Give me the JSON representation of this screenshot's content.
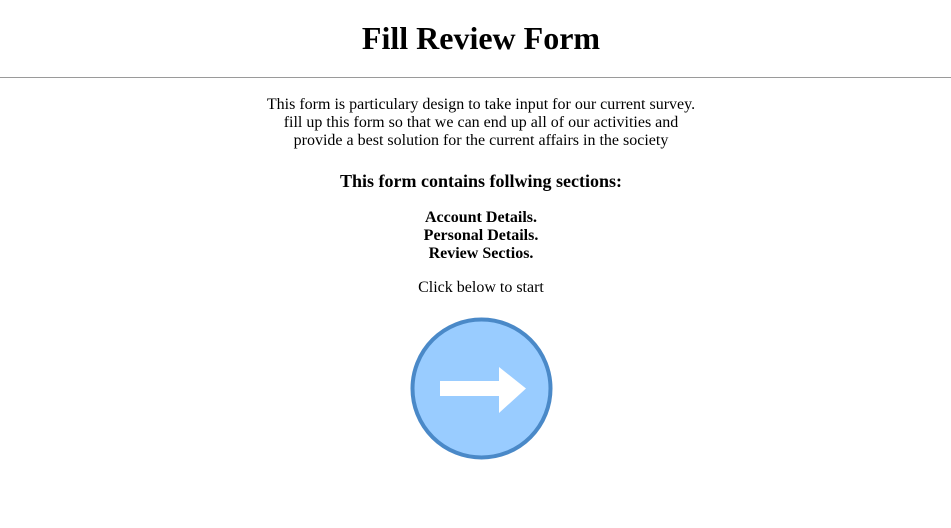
{
  "header": {
    "title": "Fill Review Form"
  },
  "intro": {
    "lines": [
      "This form is particulary design to take input for our current survey.",
      "fill up this form so that we can end up all of our activities and",
      "provide a best solution for the current affairs in the society"
    ]
  },
  "sections": {
    "heading": "This form contains follwing sections:",
    "items": [
      "Account Details.",
      "Personal Details.",
      "Review Sectios."
    ]
  },
  "start": {
    "prompt": "Click below to start",
    "button_icon": "arrow-right-icon",
    "colors": {
      "fill": "#99ccff",
      "stroke": "#4a89c8",
      "arrow": "#ffffff"
    }
  }
}
